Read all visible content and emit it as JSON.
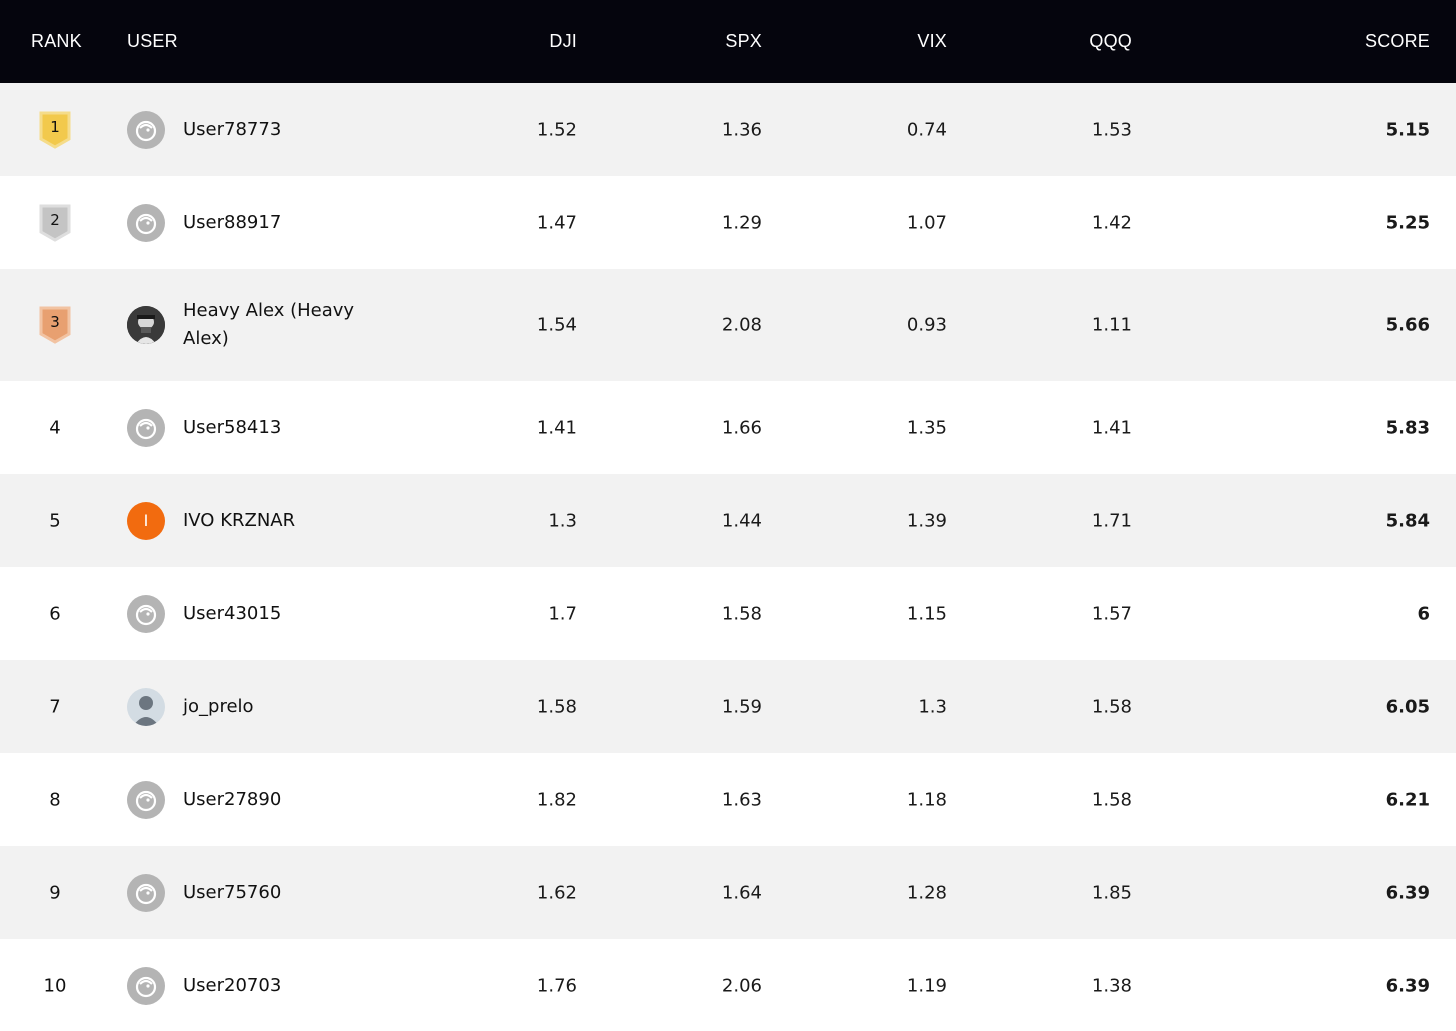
{
  "header": {
    "rank": "RANK",
    "user": "USER",
    "dji": "DJI",
    "spx": "SPX",
    "vix": "VIX",
    "qqq": "QQQ",
    "score": "SCORE"
  },
  "rows": [
    {
      "rank": "1",
      "user": "User78773",
      "dji": "1.52",
      "spx": "1.36",
      "vix": "0.74",
      "qqq": "1.53",
      "score": "5.15"
    },
    {
      "rank": "2",
      "user": "User88917",
      "dji": "1.47",
      "spx": "1.29",
      "vix": "1.07",
      "qqq": "1.42",
      "score": "5.25"
    },
    {
      "rank": "3",
      "user": "Heavy Alex (Heavy Alex)",
      "dji": "1.54",
      "spx": "2.08",
      "vix": "0.93",
      "qqq": "1.11",
      "score": "5.66"
    },
    {
      "rank": "4",
      "user": "User58413",
      "dji": "1.41",
      "spx": "1.66",
      "vix": "1.35",
      "qqq": "1.41",
      "score": "5.83"
    },
    {
      "rank": "5",
      "user": "IVO KRZNAR",
      "avatar_initial": "I",
      "dji": "1.3",
      "spx": "1.44",
      "vix": "1.39",
      "qqq": "1.71",
      "score": "5.84"
    },
    {
      "rank": "6",
      "user": "User43015",
      "dji": "1.7",
      "spx": "1.58",
      "vix": "1.15",
      "qqq": "1.57",
      "score": "6"
    },
    {
      "rank": "7",
      "user": "jo_prelo",
      "dji": "1.58",
      "spx": "1.59",
      "vix": "1.3",
      "qqq": "1.58",
      "score": "6.05"
    },
    {
      "rank": "8",
      "user": "User27890",
      "dji": "1.82",
      "spx": "1.63",
      "vix": "1.18",
      "qqq": "1.58",
      "score": "6.21"
    },
    {
      "rank": "9",
      "user": "User75760",
      "dji": "1.62",
      "spx": "1.64",
      "vix": "1.28",
      "qqq": "1.85",
      "score": "6.39"
    },
    {
      "rank": "10",
      "user": "User20703",
      "dji": "1.76",
      "spx": "2.06",
      "vix": "1.19",
      "qqq": "1.38",
      "score": "6.39"
    }
  ],
  "colors": {
    "header_bg": "#05050d",
    "gold": "#f2c94c",
    "silver": "#c4c4c4",
    "bronze": "#e8a070",
    "avatar_orange": "#f26b0f"
  },
  "icons": {
    "default_avatar": "bird-avatar-icon",
    "rank_badge": "shield-badge-icon"
  }
}
